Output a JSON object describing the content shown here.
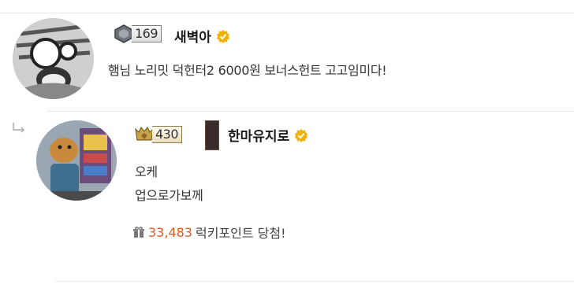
{
  "comments": [
    {
      "level": "169",
      "nickname": "새벽아",
      "text": "햄님 노리밋 덕헌터2 6000원 보너스헌트 고고임미다!"
    }
  ],
  "reply": {
    "level": "430",
    "nickname": "한마유지로",
    "lines": [
      "오케",
      "업으로가보께"
    ],
    "lucky_points": "33,483",
    "lucky_label": "럭키포인트 당첨!"
  },
  "colors": {
    "accent_orange": "#e55a1c",
    "verified_gold": "#f2b203",
    "divider": "#e6e6e6"
  },
  "icons": {
    "reply": "reply-arrow-icon",
    "verified": "verified-badge-icon",
    "gift": "gift-icon",
    "level": "level-badge-icon"
  }
}
